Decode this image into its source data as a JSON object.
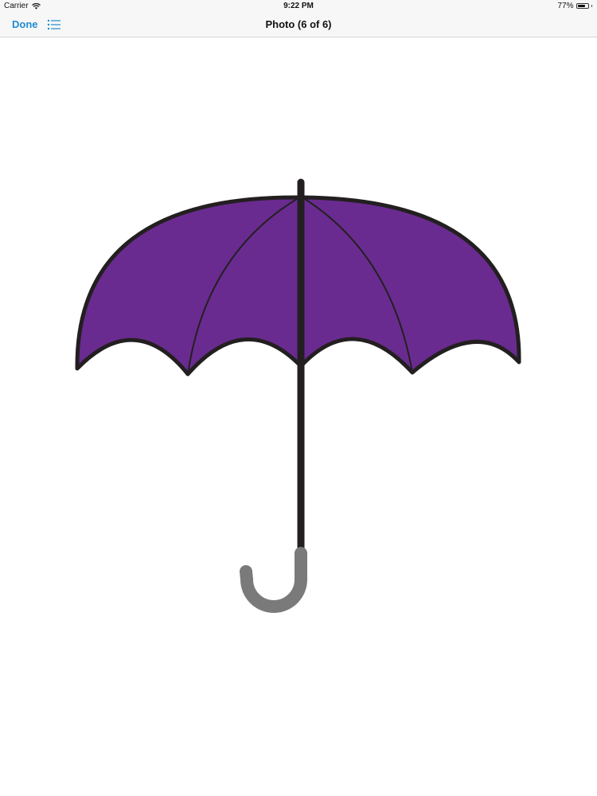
{
  "status_bar": {
    "carrier": "Carrier",
    "wifi_icon": "wifi-icon",
    "time": "9:22 PM",
    "battery_percent": "77%",
    "battery_level": 0.77
  },
  "nav": {
    "done_label": "Done",
    "list_icon": "list-icon",
    "title": "Photo (6 of 6)"
  },
  "photo": {
    "subject_icon": "umbrella-icon",
    "colors": {
      "canopy": "#6a2b90",
      "outline": "#231f20",
      "handle": "#7a7a7a"
    }
  }
}
